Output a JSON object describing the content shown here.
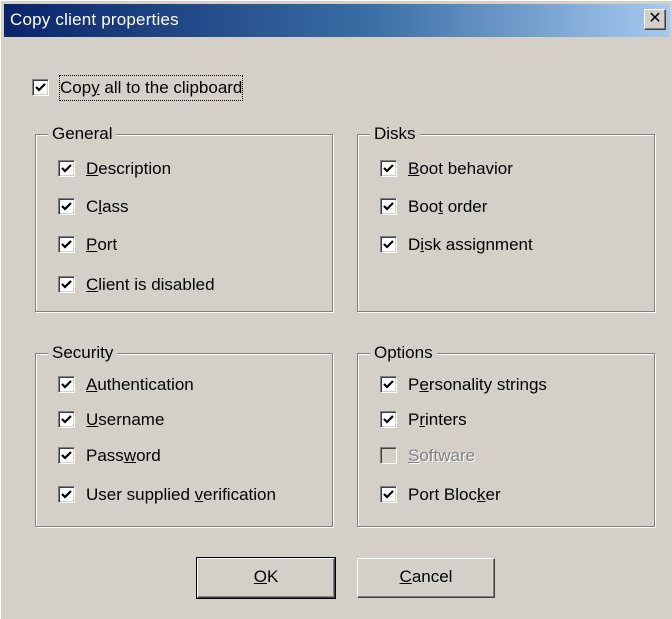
{
  "window": {
    "title": "Copy client properties",
    "close_glyph": "✕"
  },
  "copy_all": {
    "label": "Copy all to the clipboard",
    "accel": "y",
    "checked": true
  },
  "groups": {
    "general": {
      "title": "General",
      "items": [
        {
          "label": "Description",
          "accel": "D",
          "checked": true,
          "enabled": true
        },
        {
          "label": "Class",
          "accel": "l",
          "checked": true,
          "enabled": true
        },
        {
          "label": "Port",
          "accel": "P",
          "checked": true,
          "enabled": true
        },
        {
          "label": "Client is disabled",
          "accel": "C",
          "checked": true,
          "enabled": true
        }
      ]
    },
    "disks": {
      "title": "Disks",
      "items": [
        {
          "label": "Boot behavior",
          "accel": "B",
          "checked": true,
          "enabled": true
        },
        {
          "label": "Boot order",
          "accel": "t",
          "checked": true,
          "enabled": true
        },
        {
          "label": "Disk assignment",
          "accel": "i",
          "checked": true,
          "enabled": true
        }
      ]
    },
    "security": {
      "title": "Security",
      "items": [
        {
          "label": "Authentication",
          "accel": "A",
          "checked": true,
          "enabled": true
        },
        {
          "label": "Username",
          "accel": "U",
          "checked": true,
          "enabled": true
        },
        {
          "label": "Password",
          "accel": "w",
          "checked": true,
          "enabled": true
        },
        {
          "label": "User supplied verification",
          "accel": "v",
          "checked": true,
          "enabled": true
        }
      ]
    },
    "options": {
      "title": "Options",
      "items": [
        {
          "label": "Personality strings",
          "accel": "e",
          "checked": true,
          "enabled": true
        },
        {
          "label": "Printers",
          "accel": "r",
          "checked": true,
          "enabled": true
        },
        {
          "label": "Software",
          "accel": "S",
          "checked": false,
          "enabled": false
        },
        {
          "label": "Port Blocker",
          "accel": "k",
          "checked": true,
          "enabled": true
        }
      ]
    }
  },
  "buttons": {
    "ok": {
      "label": "OK",
      "accel": "O"
    },
    "cancel": {
      "label": "Cancel",
      "accel": "C"
    }
  },
  "icons": {
    "checkbox": "checkmark-icon",
    "close": "close-icon"
  }
}
